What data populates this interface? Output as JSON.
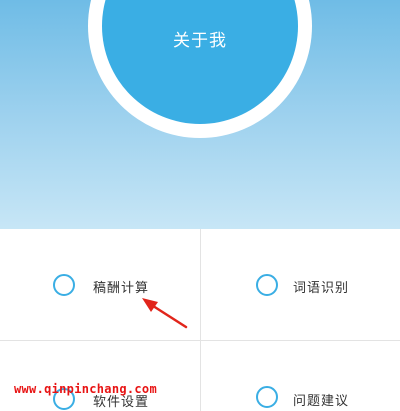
{
  "header": {
    "about_label": "关于我"
  },
  "menu": {
    "items": [
      {
        "label": "稿酬计算",
        "icon": "circle-outline-icon"
      },
      {
        "label": "词语识别",
        "icon": "circle-outline-icon"
      },
      {
        "label": "软件设置",
        "icon": "circle-outline-icon"
      },
      {
        "label": "问题建议",
        "icon": "circle-outline-icon"
      }
    ]
  },
  "annotation": {
    "arrow_color": "#e1251b"
  },
  "watermark": {
    "text": "www.qinpinchang.com"
  },
  "colors": {
    "accent": "#3aaee4",
    "hero_top": "#6fbce6",
    "hero_bottom": "#c7e6f6",
    "watermark": "#e81414"
  }
}
